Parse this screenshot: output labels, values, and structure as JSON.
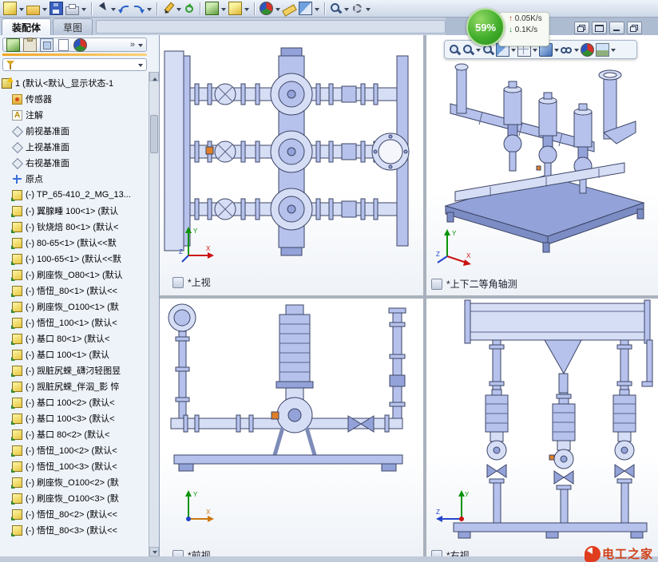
{
  "toolbar_tabs": {
    "assembly": "装配体",
    "sketch": "草图"
  },
  "performance_overlay": {
    "percent": "59%",
    "upload": "0.05K/s",
    "download": "0.1K/s"
  },
  "viewports": {
    "top_left": {
      "label": "*上视"
    },
    "top_right": {
      "label": "*上下二等角轴测"
    },
    "bottom_left": {
      "label": "*前视"
    },
    "bottom_right": {
      "label": "*右视"
    }
  },
  "triad": {
    "x": "X",
    "y": "Y",
    "z": "Z"
  },
  "filter": {
    "placeholder": ""
  },
  "icons": {
    "up_arrow": "↑",
    "down_arrow": "↓",
    "chevron_right": "»",
    "dropdown_arrow": "css-triangle",
    "funnel": "css-shape",
    "magnifier": "css-shape",
    "rgb_sphere": "css-conic-gradient"
  },
  "watermark": {
    "text": "电工之家"
  },
  "toolbars": {
    "standard": [
      {
        "n": "new-document",
        "t": "cube-y"
      },
      {
        "n": "dropdown",
        "t": "dd"
      },
      {
        "n": "open-document",
        "t": "folder"
      },
      {
        "n": "dropdown",
        "t": "dd"
      },
      {
        "n": "save",
        "t": "floppy"
      },
      {
        "n": "print",
        "t": "printer"
      },
      {
        "n": "dropdown",
        "t": "dd"
      },
      {
        "n": "sep",
        "t": "sep"
      },
      {
        "n": "select",
        "t": "cursor"
      },
      {
        "n": "dropdown",
        "t": "dd"
      },
      {
        "n": "undo",
        "t": "arrow-l"
      },
      {
        "n": "redo",
        "t": "arrow-r"
      },
      {
        "n": "dropdown",
        "t": "dd"
      },
      {
        "n": "sep",
        "t": "sep"
      },
      {
        "n": "sketch",
        "t": "pencil"
      },
      {
        "n": "dropdown",
        "t": "dd"
      },
      {
        "n": "rebuild",
        "t": "refresh"
      },
      {
        "n": "sep",
        "t": "sep"
      },
      {
        "n": "assembly",
        "t": "cube-g"
      },
      {
        "n": "dropdown",
        "t": "dd"
      },
      {
        "n": "part",
        "t": "cube-y"
      },
      {
        "n": "dropdown",
        "t": "dd"
      },
      {
        "n": "sep",
        "t": "sep"
      },
      {
        "n": "edit-appearance",
        "t": "ball-rgb"
      },
      {
        "n": "dropdown",
        "t": "dd"
      },
      {
        "n": "measure",
        "t": "ruler"
      },
      {
        "n": "section-view",
        "t": "section"
      },
      {
        "n": "dropdown",
        "t": "dd"
      },
      {
        "n": "sep",
        "t": "sep"
      },
      {
        "n": "zoom",
        "t": "mag"
      },
      {
        "n": "dropdown",
        "t": "dd"
      },
      {
        "n": "options",
        "t": "gear"
      },
      {
        "n": "dropdown",
        "t": "dd"
      }
    ],
    "heads_up": [
      {
        "n": "zoom-fit",
        "t": "mag"
      },
      {
        "n": "zoom-area",
        "t": "mag"
      },
      {
        "n": "dropdown",
        "t": "dd"
      },
      {
        "n": "zoom-in-out",
        "t": "mag"
      },
      {
        "n": "section-view",
        "t": "section"
      },
      {
        "n": "dropdown",
        "t": "dd"
      },
      {
        "n": "view-orientation",
        "t": "cube-view"
      },
      {
        "n": "dropdown",
        "t": "dd"
      },
      {
        "n": "display-style",
        "t": "shaded"
      },
      {
        "n": "dropdown",
        "t": "dd"
      },
      {
        "n": "hide-show-items",
        "t": "glasses"
      },
      {
        "n": "dropdown",
        "t": "dd"
      },
      {
        "n": "edit-appearance",
        "t": "ball-rgb"
      },
      {
        "n": "apply-scene",
        "t": "scene"
      },
      {
        "n": "dropdown",
        "t": "dd"
      }
    ],
    "panel_tabs": [
      {
        "n": "featuremanager-tab",
        "t": "cube-g"
      },
      {
        "n": "propertymanager-tab",
        "t": "clipboard"
      },
      {
        "n": "configurationmanager-tab",
        "t": "stack"
      },
      {
        "n": "dimxpert-tab",
        "t": "page"
      },
      {
        "n": "displaymanager-tab",
        "t": "ball-rgb"
      }
    ]
  },
  "tree": {
    "items": [
      {
        "icon": "assembly-root",
        "label": "1 (默认<默认_显示状态-1"
      },
      {
        "icon": "sensor-folder",
        "label": "传感器"
      },
      {
        "icon": "annotations-folder",
        "label": "注解"
      },
      {
        "icon": "plane",
        "label": "前视基准面"
      },
      {
        "icon": "plane",
        "label": "上视基准面"
      },
      {
        "icon": "plane",
        "label": "右视基准面"
      },
      {
        "icon": "origin",
        "label": "原点"
      },
      {
        "icon": "part",
        "label": "(-) TP_65-410_2_MG_13..."
      },
      {
        "icon": "part",
        "label": "(-) 翼腺畽 100<1> (默认"
      },
      {
        "icon": "part",
        "label": "(-) 钬烧焙 80<1> (默认<"
      },
      {
        "icon": "part",
        "label": "(-) 80-65<1> (默认<<默"
      },
      {
        "icon": "part",
        "label": "(-) 100-65<1> (默认<<默"
      },
      {
        "icon": "part",
        "label": "(-) 刷座恢_O80<1> (默认"
      },
      {
        "icon": "part",
        "label": "(-) 悟忸_80<1> (默认<<"
      },
      {
        "icon": "part",
        "label": "(-) 刷座恢_O100<1> (默"
      },
      {
        "icon": "part",
        "label": "(-) 悟忸_100<1> (默认<"
      },
      {
        "icon": "part",
        "label": "(-) 基口 80<1> (默认<"
      },
      {
        "icon": "part",
        "label": "(-) 基口 100<1> (默认"
      },
      {
        "icon": "part",
        "label": "(-) 觊脏尻蝾_礴汈轻图昱"
      },
      {
        "icon": "part",
        "label": "(-) 觊脏尻蝾_伴泅_影 悴"
      },
      {
        "icon": "part",
        "label": "(-) 基口 100<2> (默认<"
      },
      {
        "icon": "part",
        "label": "(-) 基口 100<3> (默认<"
      },
      {
        "icon": "part",
        "label": "(-) 基口 80<2> (默认<"
      },
      {
        "icon": "part",
        "label": "(-) 悟忸_100<2> (默认<"
      },
      {
        "icon": "part",
        "label": "(-) 悟忸_100<3> (默认<"
      },
      {
        "icon": "part",
        "label": "(-) 刷座恢_O100<2> (默"
      },
      {
        "icon": "part",
        "label": "(-) 刷座恢_O100<3> (默"
      },
      {
        "icon": "part",
        "label": "(-) 悟忸_80<2> (默认<<"
      },
      {
        "icon": "part",
        "label": "(-) 悟忸_80<3> (默认<<"
      }
    ]
  }
}
